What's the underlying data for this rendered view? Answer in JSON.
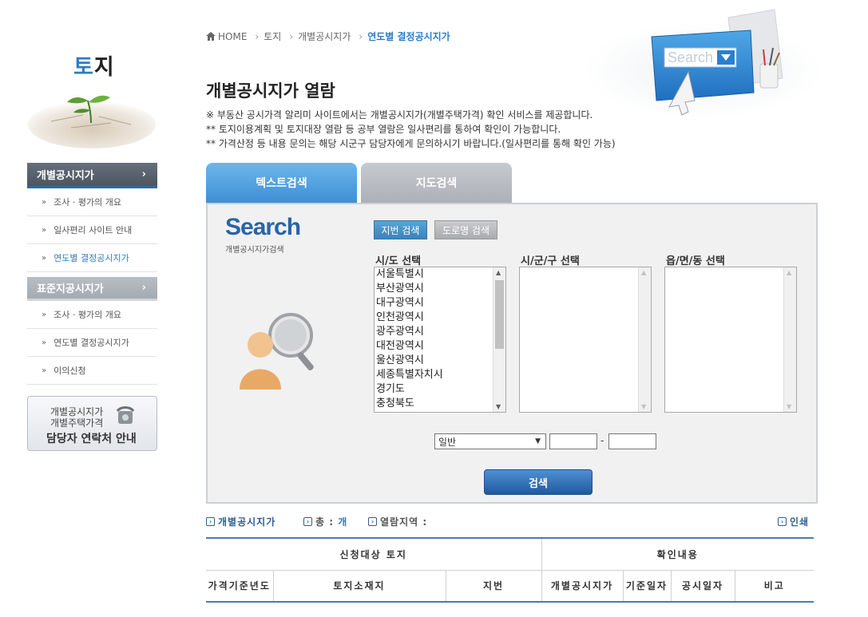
{
  "sidebar": {
    "title_first": "토",
    "title_rest": "지",
    "menu": [
      {
        "label": "개별공시지가",
        "type": "head-dark"
      },
      {
        "label": "조사 · 평가의 개요",
        "type": "item"
      },
      {
        "label": "일사편리 사이트 안내",
        "type": "item"
      },
      {
        "label": "연도별 결정공시지가",
        "type": "item-active"
      },
      {
        "label": "표준지공시지가",
        "type": "head-light"
      },
      {
        "label": "조사 · 평가의 개요",
        "type": "item"
      },
      {
        "label": "연도별 결정공시지가",
        "type": "item"
      },
      {
        "label": "이의신청",
        "type": "item"
      }
    ],
    "contact": {
      "line1": "개별공시지가",
      "line2": "개별주택가격",
      "line3": "담당자 연락처 안내"
    }
  },
  "breadcrumb": [
    "HOME",
    "토지",
    "개별공시지가",
    "연도별 결정공시지가"
  ],
  "header_illustration_text": "Search",
  "page_title": "개별공시지가 열람",
  "notes": [
    "※ 부동산 공시가격 알리미 사이트에서는 개별공시지가(개별주택가격) 확인 서비스를 제공합니다.",
    "** 토지이용계획 및 토지대장 열람 등 공부 열람은 일사편리를 통하여 확인이 가능합니다.",
    "** 가격산정 등 내용 문의는 해당 시군구 담당자에게 문의하시기 바랍니다.(일사편리를 통해 확인 가능)"
  ],
  "tabs": [
    "텍스트검색",
    "지도검색"
  ],
  "search": {
    "logo": "Search",
    "logo_sub": "개별공시지가검색",
    "btn_jibun": "지번 검색",
    "btn_road": "도로명 검색",
    "label_sido": "시/도 선택",
    "label_sigungu": "시/군/구 선택",
    "label_dong": "읍/면/동 선택",
    "sido_options": [
      "서울특별시",
      "부산광역시",
      "대구광역시",
      "인천광역시",
      "광주광역시",
      "대전광역시",
      "울산광역시",
      "세종특별자치시",
      "경기도",
      "충청북도"
    ],
    "type_select": "일반",
    "dash": "-",
    "submit": "검색"
  },
  "result_bar": {
    "item1": "개별공시지가",
    "item2_label": "총 :",
    "item2_value": "개",
    "item3": "열람지역 :",
    "print": "인쇄"
  },
  "table": {
    "group1": "신청대상 토지",
    "group2": "확인내용",
    "columns": [
      "가격기준년도",
      "토지소재지",
      "지번",
      "개별공시지가",
      "기준일자",
      "공시일자",
      "비고"
    ]
  },
  "colors": {
    "accent": "#2f7bc5",
    "dark_menu": "#555e69",
    "search_button": "#2a64a8"
  }
}
